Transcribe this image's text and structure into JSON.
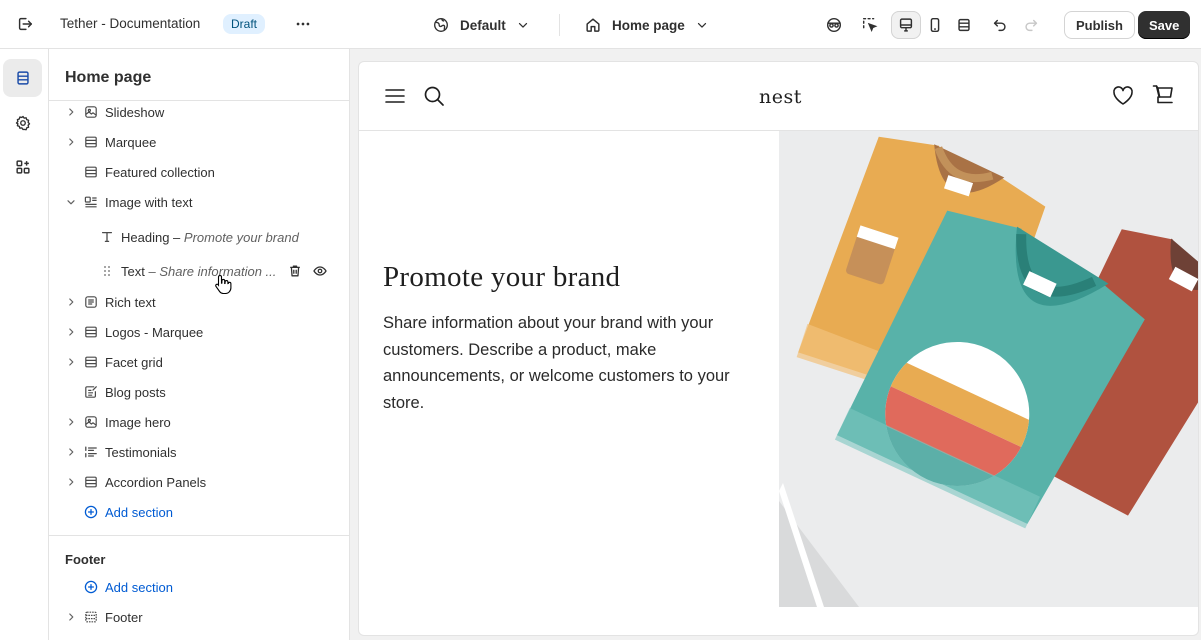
{
  "topbar": {
    "store_title": "Tether - Documentation",
    "status_badge": "Draft",
    "theme": "Default",
    "page": "Home page",
    "publish_label": "Publish",
    "save_label": "Save",
    "tools": [
      "inspector-icon",
      "select-element-icon",
      "desktop-icon",
      "mobile-icon",
      "full-width-icon",
      "undo-icon",
      "redo-icon"
    ]
  },
  "rail": {
    "items": [
      "sections-icon",
      "settings-icon",
      "apps-icon"
    ]
  },
  "sidebar": {
    "title": "Home page",
    "sections": [
      {
        "label": "Slideshow",
        "icon": "slideshow-icon",
        "expandable": true
      },
      {
        "label": "Marquee",
        "icon": "layout-icon",
        "expandable": true
      },
      {
        "label": "Featured collection",
        "icon": "layout-icon",
        "expandable": false
      },
      {
        "label": "Image with text",
        "icon": "image-text-icon",
        "expandable": true,
        "expanded": true
      },
      {
        "label": "Rich text",
        "icon": "text-block-icon",
        "expandable": true
      },
      {
        "label": "Logos - Marquee",
        "icon": "layout-icon",
        "expandable": true
      },
      {
        "label": "Facet grid",
        "icon": "layout-icon",
        "expandable": true
      },
      {
        "label": "Blog posts",
        "icon": "blog-icon",
        "expandable": false
      },
      {
        "label": "Image hero",
        "icon": "image-icon",
        "expandable": true
      },
      {
        "label": "Testimonials",
        "icon": "list-icon",
        "expandable": true
      },
      {
        "label": "Accordion Panels",
        "icon": "layout-icon",
        "expandable": true
      }
    ],
    "blocks": [
      {
        "label": "Heading",
        "sep": " – ",
        "detail": "Promote your brand"
      },
      {
        "label": "Text",
        "sep": " – ",
        "detail": "Share information ..."
      }
    ],
    "add_section": "Add section",
    "footer_group": {
      "title": "Footer",
      "add_section": "Add section",
      "sections": [
        {
          "label": "Footer",
          "icon": "layout-icon"
        }
      ]
    }
  },
  "preview": {
    "logo": "nest",
    "heading": "Promote your brand",
    "body": "Share information about your brand with your customers. Describe a product, make announcements, or welcome customers to your store.",
    "header_icons": [
      "menu-icon",
      "search-icon",
      "heart-icon",
      "cart-icon"
    ]
  },
  "colors": {
    "accent": "#005bd3",
    "badge_bg": "#e0f0ff",
    "save_bg": "#303030",
    "art_bg": "#ebeced",
    "shirt_orange": "#e8ab52",
    "shirt_teal": "#58b2a9",
    "shirt_red": "#b0523f"
  }
}
